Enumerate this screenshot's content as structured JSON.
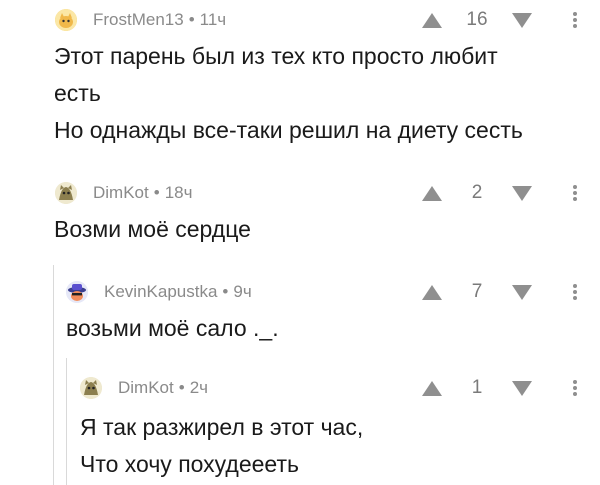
{
  "comments": [
    {
      "author": "FrostMen13",
      "separator": "•",
      "time": "11ч",
      "score": "16",
      "lines": [
        "Этот парень был из тех кто просто любит",
        "есть",
        "Но однажды все-таки решил на диету сесть"
      ],
      "avatar_color": "#f2c94c"
    },
    {
      "author": "DimKot",
      "separator": "•",
      "time": "18ч",
      "score": "2",
      "lines": [
        "Возми моё сердце"
      ],
      "avatar_color": "#9a8c5a"
    },
    {
      "author": "KevinKapustka",
      "separator": "•",
      "time": "9ч",
      "score": "7",
      "lines": [
        "возьми моё сало ._."
      ],
      "avatar_color": "#6a5acd"
    },
    {
      "author": "DimKot",
      "separator": "•",
      "time": "2ч",
      "score": "1",
      "lines": [
        "Я так разжирел в этот час,",
        "Что хочу похудеееть"
      ],
      "avatar_color": "#9a8c5a"
    }
  ]
}
